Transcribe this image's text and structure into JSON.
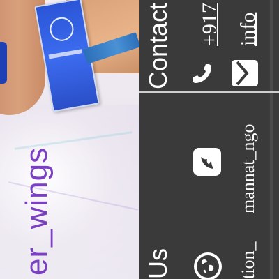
{
  "photo": {
    "caption": "er_wings"
  },
  "contact": {
    "heading": "Contact",
    "phone_text": "+917",
    "email_text": "info",
    "handle_text": "mannat_ngo",
    "site_fragment": "tion_",
    "section_heading": "Us"
  },
  "icons": {
    "phone": "phone-icon",
    "email": "envelope-icon",
    "social": "bird-logo-icon",
    "globe": "globe-icon"
  },
  "colors": {
    "panel": "#3a3a3a",
    "caption": "#7b3fc4",
    "text": "#ffffff"
  }
}
